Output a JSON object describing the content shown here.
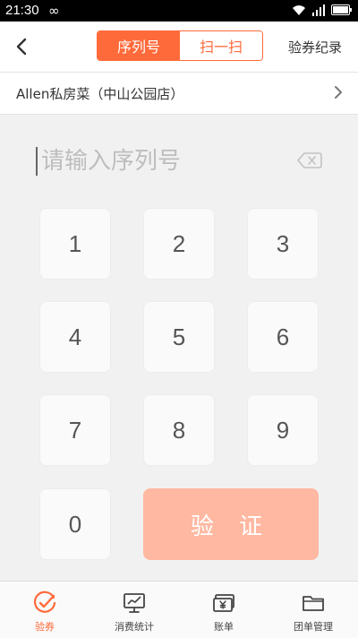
{
  "status_bar": {
    "time": "21:30",
    "link_glyph": "∞"
  },
  "header": {
    "tabs": [
      {
        "label": "序列号",
        "active": true
      },
      {
        "label": "扫一扫",
        "active": false
      }
    ],
    "records_label": "验券纪录"
  },
  "store": {
    "name": "Allen私房菜（中山公园店）"
  },
  "serial_input": {
    "placeholder": "请输入序列号",
    "value": ""
  },
  "keypad": {
    "keys": [
      "1",
      "2",
      "3",
      "4",
      "5",
      "6",
      "7",
      "8",
      "9",
      "0"
    ],
    "verify_label": "验 证"
  },
  "bottom_nav": {
    "items": [
      {
        "label": "验券",
        "icon": "check-circle-icon",
        "active": true
      },
      {
        "label": "消费统计",
        "icon": "monitor-chart-icon",
        "active": false
      },
      {
        "label": "账单",
        "icon": "bill-yen-icon",
        "active": false
      },
      {
        "label": "团单管理",
        "icon": "folder-icon",
        "active": false
      }
    ]
  },
  "colors": {
    "accent": "#ff6a3a",
    "verify_disabled": "#ffb8a1",
    "background": "#f1f1f1"
  }
}
